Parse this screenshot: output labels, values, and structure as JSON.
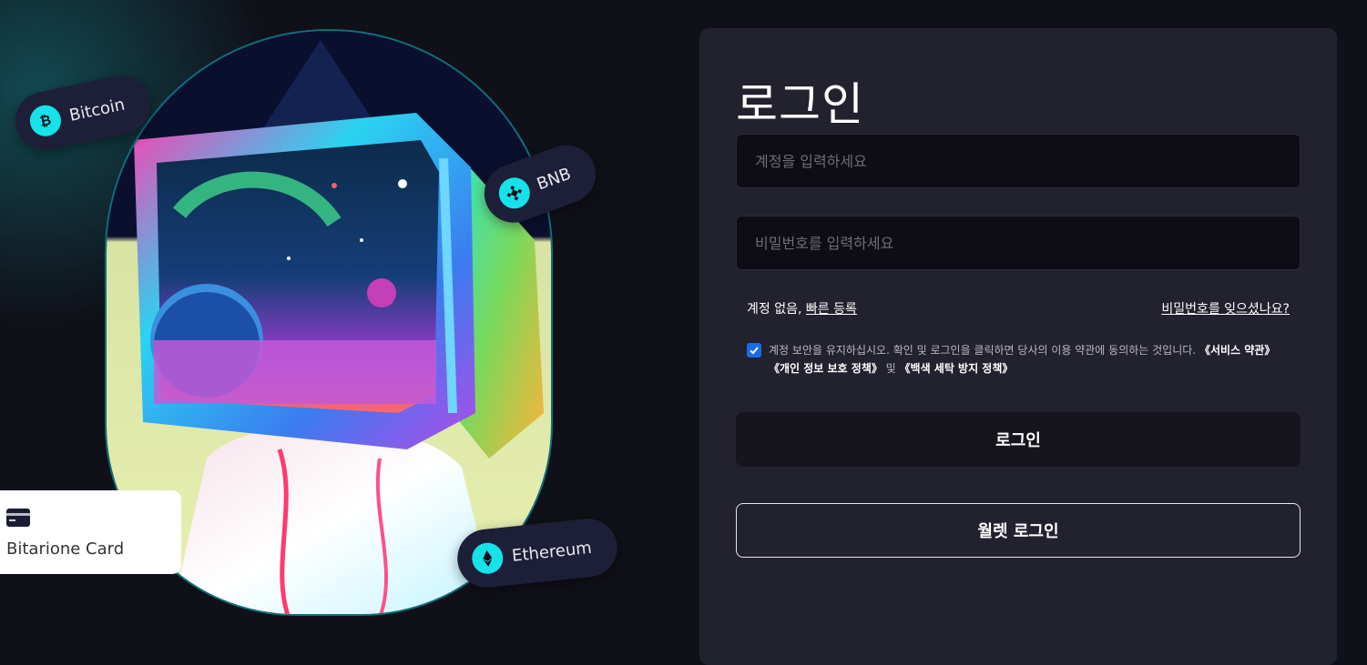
{
  "hero": {
    "badges": [
      {
        "label": "Bitcoin",
        "icon": "bitcoin-icon"
      },
      {
        "label": "BNB",
        "icon": "bnb-icon"
      },
      {
        "label": "Ethereum",
        "icon": "ethereum-icon"
      }
    ],
    "card": {
      "label": "Bitarione Card",
      "icon": "credit-card-icon"
    }
  },
  "login": {
    "title": "로그인",
    "account_placeholder": "계정을 입력하세요",
    "password_placeholder": "비밀번호를 입력하세요",
    "no_account_text": "계정 없음,",
    "quick_signup_link": "빠른 등록",
    "forgot_password_link": "비밀번호를 잊으셨나요?",
    "agreement": {
      "checked": true,
      "text": "계정 보안을 유지하십시오. 확인 및 로그인을 클릭하면 당사의 이용 약관에 동의하는 것입니다. ",
      "terms_link": "《서비스 약관》",
      "privacy_link": "《개인 정보 보호 정책》",
      "and_text": " 및 ",
      "aml_link": "《백색 세탁 방지 정책》"
    },
    "login_button": "로그인",
    "wallet_login_button": "월렛 로그인"
  },
  "colors": {
    "background": "#101018",
    "panel": "#22212e",
    "accent": "#16e2ea",
    "checkbox": "#1d6ae6"
  }
}
